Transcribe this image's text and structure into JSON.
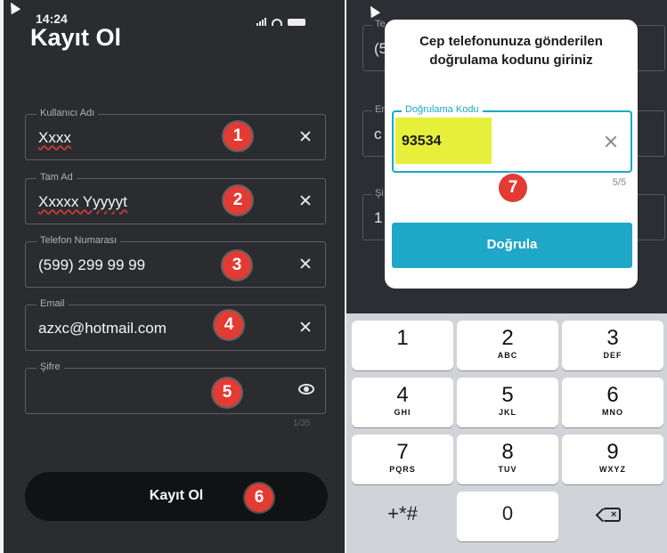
{
  "left_screen": {
    "status_time": "14:24",
    "title": "Kayıt Ol",
    "fields": [
      {
        "label": "Kullanıcı Adı",
        "value": "Xxxx",
        "badge": "1"
      },
      {
        "label": "Tam Ad",
        "value": "Xxxxx Yyyyyt",
        "badge": "2"
      },
      {
        "label": "Telefon Numarası",
        "value": "(599) 299 99 99",
        "badge": "3"
      },
      {
        "label": "Email",
        "value": "azxc@hotmail.com",
        "badge": "4"
      },
      {
        "label": "Şifre",
        "value": "",
        "badge": "5"
      }
    ],
    "password_counter": "1/35",
    "register_button": "Kayıt Ol",
    "register_badge": "6"
  },
  "right_screen": {
    "background_fields": [
      {
        "label": "Te",
        "value": "(5"
      },
      {
        "label": "Er",
        "value": "c"
      },
      {
        "label": "Şi",
        "value": "1"
      }
    ],
    "dialog": {
      "title_line1": "Cep telefonunuza gönderilen",
      "title_line2": "doğrulama kodunu giriniz",
      "code_label": "Doğrulama Kodu",
      "code_value": "93534",
      "counter": "5/5",
      "badge": "7",
      "verify_button": "Doğrula"
    },
    "keypad": [
      {
        "num": "1",
        "letters": ""
      },
      {
        "num": "2",
        "letters": "ABC"
      },
      {
        "num": "3",
        "letters": "DEF"
      },
      {
        "num": "4",
        "letters": "GHI"
      },
      {
        "num": "5",
        "letters": "JKL"
      },
      {
        "num": "6",
        "letters": "MNO"
      },
      {
        "num": "7",
        "letters": "PQRS"
      },
      {
        "num": "8",
        "letters": "TUV"
      },
      {
        "num": "9",
        "letters": "WXYZ"
      },
      {
        "num": "+*#",
        "letters": ""
      },
      {
        "num": "0",
        "letters": ""
      }
    ]
  },
  "colors": {
    "background": "#2b2c30",
    "badge": "#e23b33",
    "accent": "#1fa7c7",
    "highlight": "#e6f03a"
  }
}
